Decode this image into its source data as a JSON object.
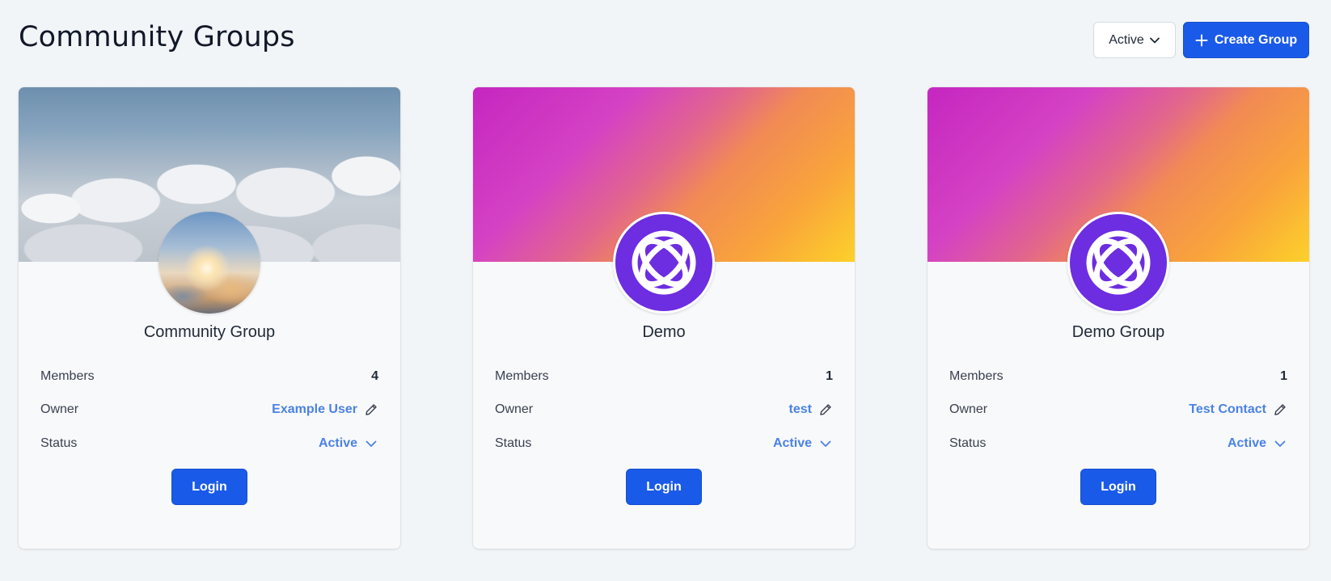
{
  "header": {
    "title": "Community Groups",
    "filter_label": "Active",
    "create_label": "Create Group"
  },
  "labels": {
    "members": "Members",
    "owner": "Owner",
    "status": "Status",
    "login": "Login"
  },
  "groups": [
    {
      "name": "Community Group",
      "members": "4",
      "owner": "Example User",
      "status": "Active",
      "banner": "clouds-photo",
      "avatar": "sunset-sky-photo"
    },
    {
      "name": "Demo",
      "members": "1",
      "owner": "test",
      "status": "Active",
      "banner": "magenta-orange-gradient",
      "avatar": "purple-orbit-logo"
    },
    {
      "name": "Demo Group",
      "members": "1",
      "owner": "Test Contact",
      "status": "Active",
      "banner": "magenta-orange-gradient",
      "avatar": "purple-orbit-logo"
    }
  ],
  "colors": {
    "primary": "#1a5ae8",
    "link": "#4b82e4",
    "logo_purple": "#6d2de0",
    "background": "#f2f5f8"
  },
  "icons": [
    "chevron-down-icon",
    "plus-icon",
    "pencil-icon"
  ]
}
